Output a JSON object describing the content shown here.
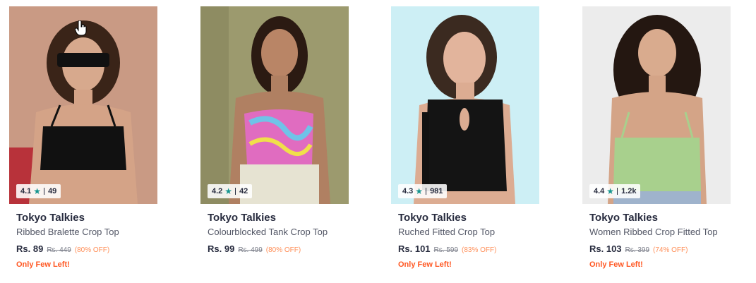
{
  "products": [
    {
      "brand": "Tokyo Talkies",
      "name": "Ribbed Bralette Crop Top",
      "price": "Rs. 89",
      "mrp": "Rs. 449",
      "discount": "(80% OFF)",
      "stock_note": "Only Few Left!",
      "rating": "4.1",
      "rating_count": "49",
      "top_color": "#111111"
    },
    {
      "brand": "Tokyo Talkies",
      "name": "Colourblocked Tank Crop Top",
      "price": "Rs. 99",
      "mrp": "Rs. 499",
      "discount": "(80% OFF)",
      "stock_note": "",
      "rating": "4.2",
      "rating_count": "42",
      "top_color": "#e06cc0"
    },
    {
      "brand": "Tokyo Talkies",
      "name": "Ruched Fitted Crop Top",
      "price": "Rs. 101",
      "mrp": "Rs. 599",
      "discount": "(83% OFF)",
      "stock_note": "Only Few Left!",
      "rating": "4.3",
      "rating_count": "981",
      "top_color": "#141414"
    },
    {
      "brand": "Tokyo Talkies",
      "name": "Women Ribbed Crop Fitted Top",
      "price": "Rs. 103",
      "mrp": "Rs. 399",
      "discount": "(74% OFF)",
      "stock_note": "Only Few Left!",
      "rating": "4.4",
      "rating_count": "1.2k",
      "top_color": "#a8d08d"
    }
  ],
  "colors": {
    "star": "#14958f",
    "discount": "#ff905a",
    "stock_note": "#ff5722"
  }
}
